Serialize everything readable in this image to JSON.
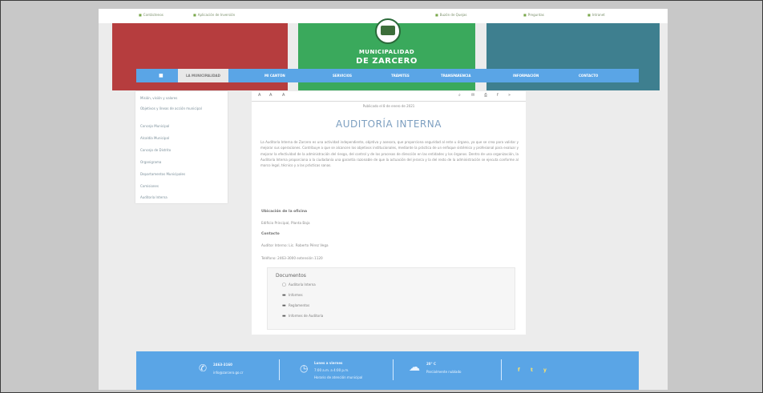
{
  "top_links": [
    "Contáctenos",
    "Aplicación de Inversión",
    "Buzón de Quejas",
    "Preguntas",
    "Intranet"
  ],
  "header": {
    "title_line1": "MUNICIPALIDAD",
    "title_line2": "DE ZARCERO"
  },
  "nav": {
    "home_icon": "home-icon",
    "items": [
      "LA MUNICIPALIDAD",
      "MI CANTÓN",
      "SERVICIOS",
      "TRÁMITES",
      "TRANSPARENCIA",
      "INFORMACIÓN",
      "CONTACTO"
    ]
  },
  "sidebar": {
    "items": [
      "Misión, visión y valores",
      "Objetivos y líneas de acción municipal",
      "Concejo Municipal",
      "Alcaldía Municipal",
      "Concejo de Distrito",
      "Organigrama",
      "Departamentos Municipales",
      "Comisiones",
      "Auditoría Interna"
    ]
  },
  "toolbar": {
    "font_smaller": "A",
    "font_reset": "A",
    "font_larger": "A"
  },
  "article": {
    "published": "Publicado el 8 de enero de 2021",
    "title": "AUDITORÍA INTERNA",
    "paragraph": "La Auditoría Interna de Zarcero es una actividad independiente, objetiva y asesora, que proporciona seguridad al ente u órgano, ya que se crea para validar y mejorar sus operaciones. Contribuye a que se alcancen los objetivos institucionales, mediante la práctica de un enfoque sistémico y profesional para evaluar y mejorar la efectividad de la administración del riesgo, del control y de los procesos de dirección en las entidades y los órganos. Dentro de una organización, la Auditoría Interna proporciona a la ciudadanía una garantía razonable de que la actuación del jerarca y la del resto de la administración se ejecuta conforme al marco legal, técnico y a las prácticas sanas.",
    "location_label": "Ubicación de la oficina",
    "location_value": "Edificio Principal, Planta Baja",
    "contact_label": "Contacto",
    "contact_value": "Auditor Interno: Lic. Roberto Pérez Vega",
    "phone_value": "Teléfono: 2463-3000 extensión 1120"
  },
  "documents": {
    "title": "Documentos",
    "items": [
      {
        "icon": "file-icon",
        "label": "Auditoría Interna"
      },
      {
        "icon": "folder-icon",
        "label": "Informes"
      },
      {
        "icon": "folder-icon",
        "label": "Reglamentos"
      },
      {
        "icon": "folder-icon",
        "label": "Informes de Auditoría"
      }
    ]
  },
  "footer": {
    "phone_title": "2463-3160",
    "email": "info@zarcero.go.cr",
    "hours_title": "Lunes a viernes",
    "hours": "7:00 a.m. a 4:00 p.m.",
    "hours_note": "Horario de atención municipal",
    "weather_temp": "20° C",
    "weather_desc": "Parcialmente nublado",
    "social": [
      "f",
      "t",
      "y"
    ]
  },
  "colors": {
    "nav_blue": "#5aa5e6",
    "header_red": "#b63d3e",
    "header_green": "#3aa95c",
    "header_teal": "#3e7f8f",
    "heading_blue": "#7d9fc0"
  }
}
